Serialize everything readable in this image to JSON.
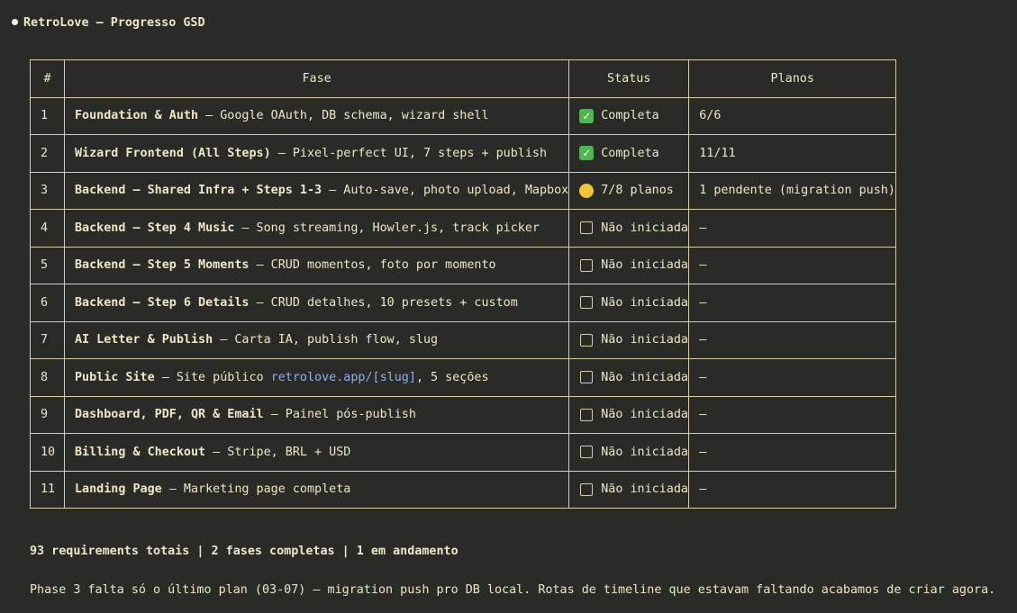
{
  "header": {
    "title": "RetroLove — Progresso GSD"
  },
  "table": {
    "columns": [
      "#",
      "Fase",
      "Status",
      "Planos"
    ],
    "rows": [
      {
        "num": "1",
        "name": "Foundation & Auth",
        "desc": " — Google OAuth, DB schema, wizard shell",
        "status_icon": "check",
        "status": "Completa",
        "planos": "6/6"
      },
      {
        "num": "2",
        "name": "Wizard Frontend (All Steps)",
        "desc": " — Pixel-perfect UI, 7 steps + publish",
        "status_icon": "check",
        "status": "Completa",
        "planos": "11/11"
      },
      {
        "num": "3",
        "name": "Backend — Shared Infra + Steps 1-3",
        "desc": " — Auto-save, photo upload, Mapbox",
        "status_icon": "progress",
        "status": "7/8 planos",
        "planos": "1 pendente (migration push)"
      },
      {
        "num": "4",
        "name": "Backend — Step 4 Music",
        "desc": " — Song streaming, Howler.js, track picker",
        "status_icon": "empty",
        "status": "Não iniciada",
        "planos": "—"
      },
      {
        "num": "5",
        "name": "Backend — Step 5 Moments",
        "desc": " — CRUD momentos, foto por momento",
        "status_icon": "empty",
        "status": "Não iniciada",
        "planos": "—"
      },
      {
        "num": "6",
        "name": "Backend — Step 6 Details",
        "desc": " — CRUD detalhes, 10 presets + custom",
        "status_icon": "empty",
        "status": "Não iniciada",
        "planos": "—"
      },
      {
        "num": "7",
        "name": "AI Letter & Publish",
        "desc": " — Carta IA, publish flow, slug",
        "status_icon": "empty",
        "status": "Não iniciada",
        "planos": "—"
      },
      {
        "num": "8",
        "name": "Public Site",
        "desc": " — Site público ",
        "link": "retrolove.app/[slug]",
        "desc_after": ", 5 seções",
        "status_icon": "empty",
        "status": "Não iniciada",
        "planos": "—"
      },
      {
        "num": "9",
        "name": "Dashboard, PDF, QR & Email",
        "desc": " — Painel pós-publish",
        "status_icon": "empty",
        "status": "Não iniciada",
        "planos": "—"
      },
      {
        "num": "10",
        "name": "Billing & Checkout",
        "desc": " — Stripe, BRL + USD",
        "status_icon": "empty",
        "status": "Não iniciada",
        "planos": "—"
      },
      {
        "num": "11",
        "name": "Landing Page",
        "desc": " — Marketing page completa",
        "status_icon": "empty",
        "status": "Não iniciada",
        "planos": "—"
      }
    ]
  },
  "summary": "93 requirements totais | 2 fases completas | 1 em andamento",
  "note": "Phase 3 falta só o último plan (03-07) — migration push pro DB local. Rotas de timeline que estavam faltando acabamos de criar agora."
}
